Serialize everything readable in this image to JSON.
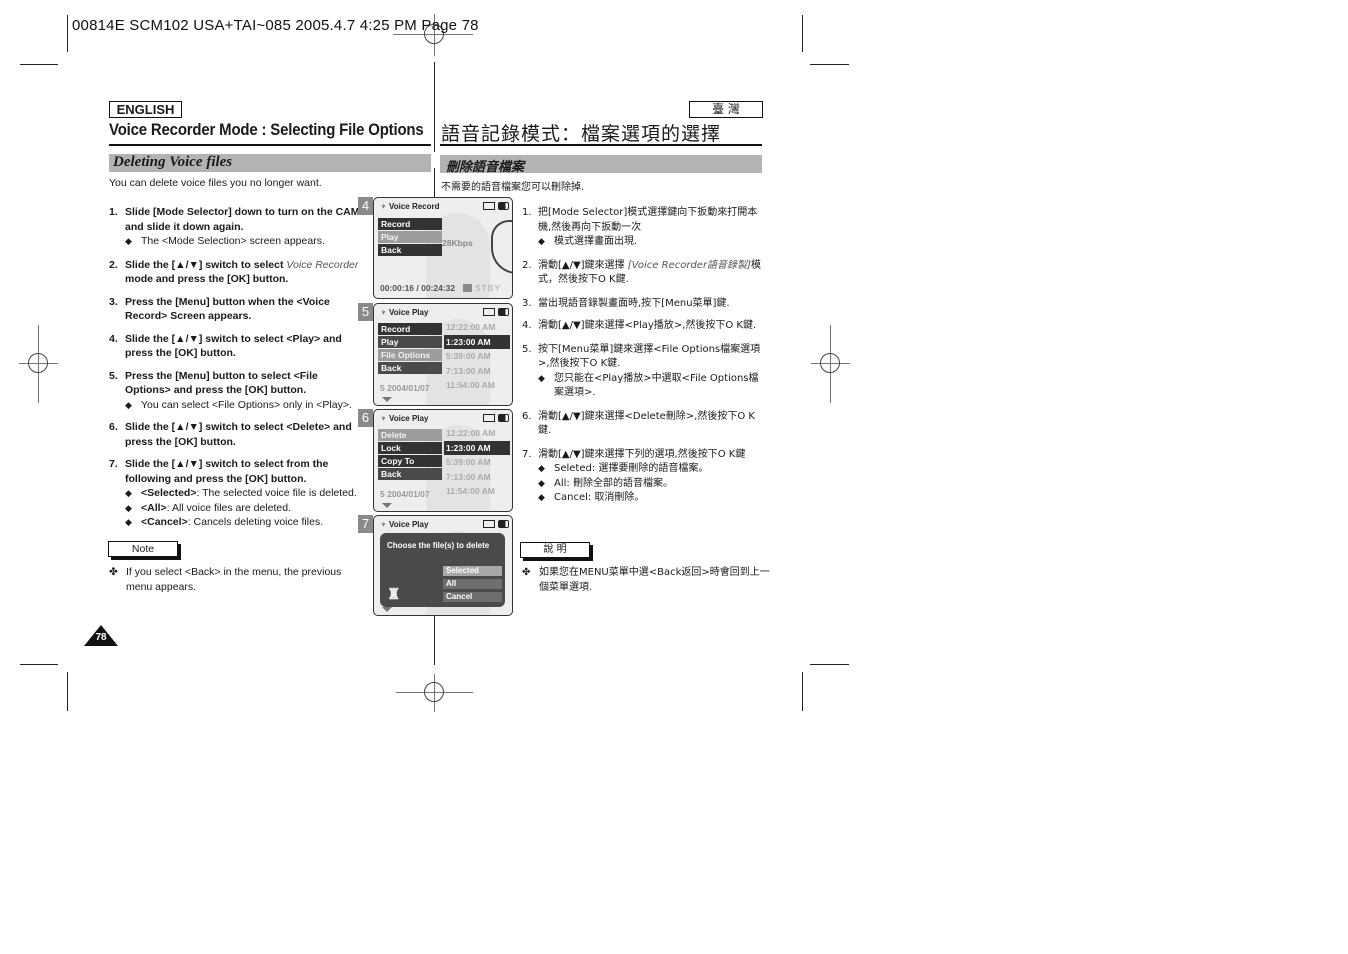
{
  "slug_line": "00814E SCM102  USA+TAI~085  2005.4.7  4:25 PM  Page 78",
  "left": {
    "language": "ENGLISH",
    "title": "Voice Recorder Mode : Selecting File Options",
    "section": "Deleting Voice files",
    "intro": "You can delete voice files you no longer want.",
    "steps": [
      {
        "num": "1.",
        "text": "Slide [Mode Selector] down to turn on the CAM and slide it down again.",
        "subs": [
          "The <Mode Selection> screen appears."
        ]
      },
      {
        "num": "2.",
        "pre": "Slide the [▲/▼] switch to select ",
        "italic": "Voice Recorder",
        "post": " mode and press the [OK] button.",
        "subs": []
      },
      {
        "num": "3.",
        "text": "Press the [Menu] button when the <Voice Record> Screen appears.",
        "subs": []
      },
      {
        "num": "4.",
        "text": "Slide the [▲/▼] switch to select <Play> and press the [OK] button.",
        "subs": []
      },
      {
        "num": "5.",
        "text": "Press the [Menu] button to select <File Options> and press the [OK] button.",
        "subs": [
          "You can select <File Options> only in <Play>."
        ]
      },
      {
        "num": "6.",
        "text": "Slide the [▲/▼] switch to select <Delete> and press the [OK] button.",
        "subs": []
      },
      {
        "num": "7.",
        "text": "Slide the [▲/▼] switch to select from the following and press the [OK] button.",
        "subs_rich": [
          {
            "b": "<Selected>",
            "t": ": The selected voice file is deleted."
          },
          {
            "b": "<All>",
            "t": ": All voice files are deleted."
          },
          {
            "b": "<Cancel>",
            "t": ": Cancels deleting voice files."
          }
        ]
      }
    ],
    "note_label": "Note",
    "note_text": "If you select <Back> in the menu, the previous menu appears.",
    "page_number": "78"
  },
  "right": {
    "language": "臺 灣",
    "title": "語音記錄模式：檔案選項的選擇",
    "section": "刪除語音檔案",
    "intro": "不需要的語音檔案您可以刪除掉.",
    "steps": [
      {
        "num": "1.",
        "text": "把[Mode Selector]模式選擇鍵向下扳動來打開本機,然後再向下扳動一次",
        "subs": [
          "模式選擇畫面出現."
        ]
      },
      {
        "num": "2.",
        "pre": "滑動[▲/▼]鍵來選擇 ",
        "italic": "[Voice Recorder語音錄製]",
        "post": "模式，然後按下O K鍵.",
        "subs": []
      },
      {
        "num": "3.",
        "text": "當出現語音錄製畫面時,按下[Menu菜單]鍵.",
        "subs": []
      },
      {
        "num": "4.",
        "text": "滑動[▲/▼]鍵來選擇<Play播放>,然後按下O K鍵.",
        "subs": []
      },
      {
        "num": "5.",
        "text": "按下[Menu菜單]鍵來選擇<File Options檔案選項>,然後按下O K鍵.",
        "subs": [
          "您只能在<Play播放>中選取<File Options檔案選項>."
        ]
      },
      {
        "num": "6.",
        "text": "滑動[▲/▼]鍵來選擇<Delete刪除>,然後按下O K鍵.",
        "subs": []
      },
      {
        "num": "7.",
        "text": "滑動[▲/▼]鍵來選擇下列的選項,然後按下O K鍵",
        "subs": [
          "Seleted: 選擇要刪除的語音檔案。",
          "All: 刪除全部的語音檔案。",
          "Cancel: 取消刪除。"
        ]
      }
    ],
    "note_label": "說 明",
    "note_text": "如果您在MENU菜單中選<Back返回>時會回到上一個菜單選項."
  },
  "screens": [
    {
      "step": "4",
      "header": "Voice Record",
      "menu": [
        {
          "label": "Record",
          "state": "normal"
        },
        {
          "label": "Play",
          "state": "selected"
        },
        {
          "label": "Back",
          "state": "normal"
        }
      ],
      "bitrate": "28Kbps",
      "time": "00:00:16 / 00:24:32",
      "status": "STBY"
    },
    {
      "step": "5",
      "header": "Voice Play",
      "menu": [
        {
          "label": "Record",
          "state": "normal"
        },
        {
          "label": "Play",
          "state": "mid"
        },
        {
          "label": "File Options",
          "state": "selected"
        },
        {
          "label": "Back",
          "state": "mid"
        }
      ],
      "times": [
        "12:22:00 AM",
        "1:23:00 AM",
        "5:39:00 AM",
        "7:13:00 AM",
        "11:54:00 AM"
      ],
      "highlighted_time": 1,
      "date": "5  2004/01/07"
    },
    {
      "step": "6",
      "header": "Voice Play",
      "menu": [
        {
          "label": "Delete",
          "state": "selected"
        },
        {
          "label": "Lock",
          "state": "normal"
        },
        {
          "label": "Copy To",
          "state": "normal"
        },
        {
          "label": "Back",
          "state": "mid"
        }
      ],
      "times": [
        "12:22:00 AM",
        "1:23:00 AM",
        "5:39:00 AM",
        "7:13:00 AM",
        "11:54:00 AM"
      ],
      "highlighted_time": 1,
      "date": "5  2004/01/07"
    },
    {
      "step": "7",
      "header": "Voice Play",
      "dialog_message": "Choose the file(s) to delete",
      "options": [
        {
          "label": "Selected",
          "state": "selected"
        },
        {
          "label": "All",
          "state": "normal"
        },
        {
          "label": "Cancel",
          "state": "normal"
        }
      ]
    }
  ],
  "icons": {
    "step_bullet": "diamond-bullet",
    "note_bullet": "four-leaf-bullet",
    "mic": "microphone-icon",
    "memory": "memory-card-icon",
    "battery": "battery-icon",
    "trash": "trash-icon",
    "scroll_down": "triangle-down-icon"
  }
}
